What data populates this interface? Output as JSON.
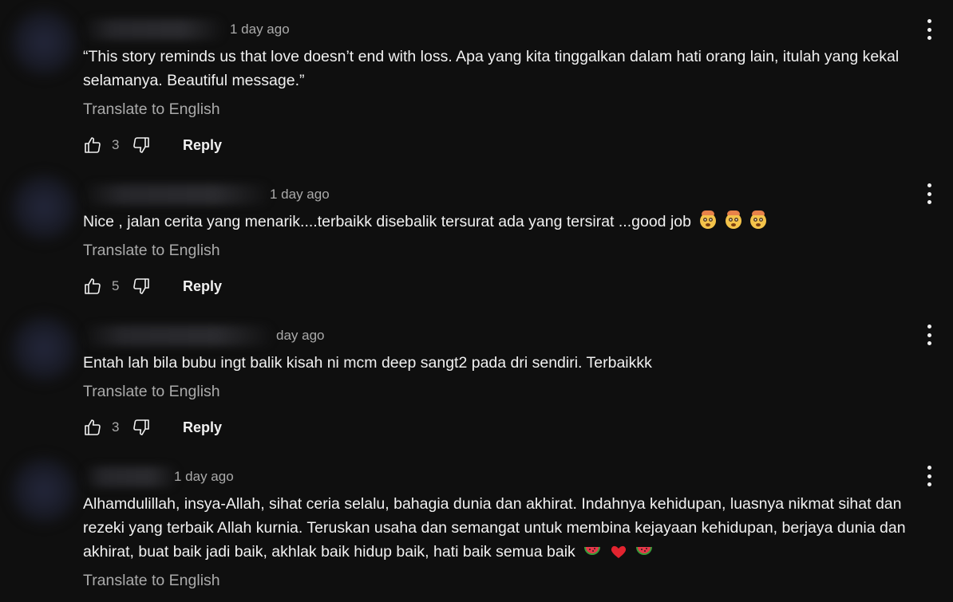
{
  "comments": [
    {
      "time": "1 day ago",
      "text": "“This story reminds us that love doesn’t end with loss. Apa yang kita tinggalkan dalam hati orang lain, itulah yang kekal selamanya. Beautiful message.”",
      "translate": "Translate to English",
      "likes": "3",
      "reply": "Reply",
      "emojis": []
    },
    {
      "time": "1 day ago",
      "text": "Nice , jalan cerita yang menarik....terbaikk disebalik tersurat ada yang tersirat ...good job",
      "translate": "Translate to English",
      "likes": "5",
      "reply": "Reply",
      "emojis": [
        "face-with-hat-emoji",
        "face-with-hat-emoji",
        "face-with-hat-emoji"
      ]
    },
    {
      "time": "day ago",
      "text": "Entah lah bila bubu ingt balik kisah ni mcm deep sangt2 pada dri sendiri. Terbaikkk",
      "translate": "Translate to English",
      "likes": "3",
      "reply": "Reply",
      "emojis": []
    },
    {
      "time": "1 day ago",
      "text": "Alhamdulillah, insya-Allah, sihat ceria selalu, bahagia dunia dan akhirat. Indahnya kehidupan, luasnya nikmat sihat dan rezeki yang terbaik Allah kurnia. Teruskan usaha dan semangat untuk membina kejayaan kehidupan, berjaya dunia dan akhirat, buat baik jadi baik, akhlak baik hidup baik, hati baik semua baik",
      "translate": "Translate to English",
      "emojis": [
        "watermelon-emoji",
        "red-heart-emoji",
        "watermelon-emoji"
      ]
    }
  ],
  "colors": {
    "background": "#0f0f0f",
    "primary_text": "#f1f1f1",
    "secondary_text": "#aaaaaa"
  },
  "icons": {
    "like": "thumbs-up-icon",
    "dislike": "thumbs-down-icon",
    "menu": "more-vert-icon"
  }
}
